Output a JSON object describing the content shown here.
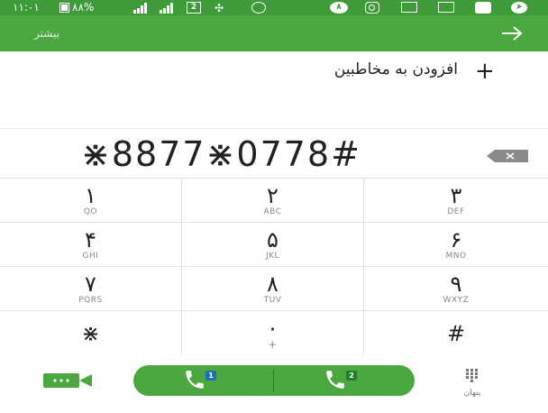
{
  "status_bar": {
    "time": "۱۱:۰۱",
    "battery_percent": "٨٨%",
    "sim_badge": "2",
    "circle_badge": "٨"
  },
  "action_bar": {
    "more_label": "بیشتر",
    "next_icon": "arrow-right-icon"
  },
  "add_to_contacts": {
    "label": "افزودن به مخاطبین",
    "icon": "plus-icon"
  },
  "dial_number": "⋇8877⋇0778#",
  "keypad": [
    {
      "digit": "١",
      "letters": "QO"
    },
    {
      "digit": "٢",
      "letters": "ABC"
    },
    {
      "digit": "٣",
      "letters": "DEF"
    },
    {
      "digit": "۴",
      "letters": "GHI"
    },
    {
      "digit": "۵",
      "letters": "JKL"
    },
    {
      "digit": "۶",
      "letters": "MNO"
    },
    {
      "digit": "٧",
      "letters": "PQRS"
    },
    {
      "digit": "٨",
      "letters": "TUV"
    },
    {
      "digit": "٩",
      "letters": "WXYZ"
    },
    {
      "digit": "⋇",
      "letters": ""
    },
    {
      "digit": "٠",
      "letters": "+"
    },
    {
      "digit": "#",
      "letters": ""
    }
  ],
  "bottom_bar": {
    "call_sim1_badge": "1",
    "call_sim2_badge": "2",
    "hide_label": "پنهان"
  },
  "colors": {
    "status_bar": "#3f9a3a",
    "action_bar": "#4aa83e",
    "call_button": "#4aa83e"
  }
}
